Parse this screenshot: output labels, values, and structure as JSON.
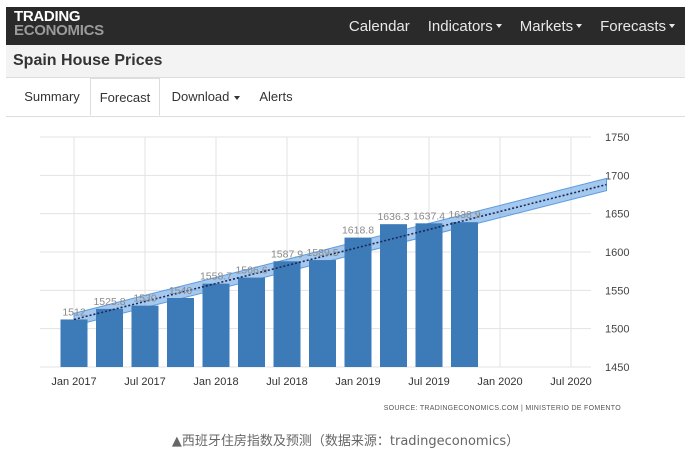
{
  "nav": {
    "logo_line1": "TRADING",
    "logo_line2": "ECONOMICS",
    "items": [
      {
        "label": "Calendar",
        "dropdown": false
      },
      {
        "label": "Indicators",
        "dropdown": true
      },
      {
        "label": "Markets",
        "dropdown": true
      },
      {
        "label": "Forecasts",
        "dropdown": true
      }
    ]
  },
  "page": {
    "title": "Spain House Prices"
  },
  "tabs": {
    "summary": "Summary",
    "forecast": "Forecast",
    "download": "Download",
    "alerts": "Alerts",
    "active": "Forecast"
  },
  "chart_data": {
    "type": "bar",
    "categories": [
      "2017Q1",
      "2017Q2",
      "2017Q3",
      "2017Q4",
      "2018Q1",
      "2018Q2",
      "2018Q3",
      "2018Q4",
      "2019Q1",
      "2019Q2",
      "2019Q3",
      "2019Q4"
    ],
    "values": [
      1512,
      1525.8,
      1530,
      1540,
      1558.7,
      1566.6,
      1587.9,
      1589.5,
      1618.8,
      1636.3,
      1637.4,
      1638.9
    ],
    "value_labels": [
      "1512",
      "1525.8",
      "1530",
      "1540",
      "1558.7",
      "1566.6",
      "1587.9",
      "1589.5",
      "1618.8",
      "1636.3",
      "1637.4",
      "1638.9"
    ],
    "x_tick_labels": [
      "Jan 2017",
      "Jul 2017",
      "Jan 2018",
      "Jul 2018",
      "Jan 2019",
      "Jul 2019",
      "Jan 2020",
      "Jul 2020"
    ],
    "y_ticks": [
      1450,
      1500,
      1550,
      1600,
      1650,
      1700,
      1750
    ],
    "ylim": [
      1450,
      1750
    ],
    "y_axis_side": "right",
    "grid": true,
    "forecast_trend": {
      "start": {
        "x": 0,
        "y": 1512
      },
      "end": {
        "x": 15,
        "y": 1688
      },
      "band_half_width": 8,
      "style": "dotted"
    },
    "colors": {
      "bar": "#3d7ab8",
      "band": "#5b9be0",
      "trend": "#1a2a55",
      "grid": "#e3e3e3",
      "label": "#8a8a8a"
    },
    "source": "SOURCE: TRADINGECONOMICS.COM  |  MINISTERIO DE FOMENTO"
  },
  "caption": "▲西班牙住房指数及预测（数据来源：tradingeconomics）"
}
